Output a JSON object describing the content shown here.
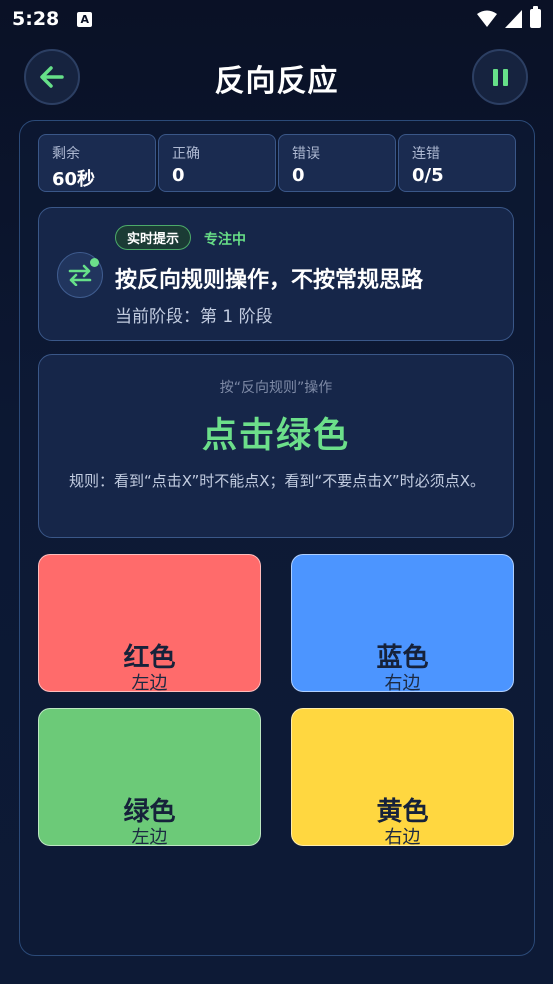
{
  "status_bar": {
    "time": "5:28",
    "notif_letter": "A"
  },
  "header": {
    "title": "反向反应"
  },
  "stats": [
    {
      "label": "剩余",
      "value": "60秒"
    },
    {
      "label": "正确",
      "value": "0"
    },
    {
      "label": "错误",
      "value": "0"
    },
    {
      "label": "连错",
      "value": "0/5"
    }
  ],
  "hint": {
    "badge": "实时提示",
    "status": "专注中",
    "title": "按反向规则操作，不按常规思路",
    "stage": "当前阶段：第 1 阶段"
  },
  "instruction": {
    "subtitle": "按“反向规则”操作",
    "command": "点击绿色",
    "rule": "规则：看到“点击X”时不能点X；看到“不要点击X”时必须点X。"
  },
  "buttons": [
    {
      "name": "红色",
      "side": "左边",
      "color": "#ff6b6b"
    },
    {
      "name": "蓝色",
      "side": "右边",
      "color": "#4c95ff"
    },
    {
      "name": "绿色",
      "side": "左边",
      "color": "#6cca78"
    },
    {
      "name": "黄色",
      "side": "右边",
      "color": "#ffd740"
    }
  ],
  "colors": {
    "accent": "#6cdf8a",
    "background": "#0c1833",
    "card": "#162649"
  },
  "icons": {
    "back": "arrow-left-icon",
    "pause": "pause-icon",
    "hint": "swap-arrows-icon"
  }
}
